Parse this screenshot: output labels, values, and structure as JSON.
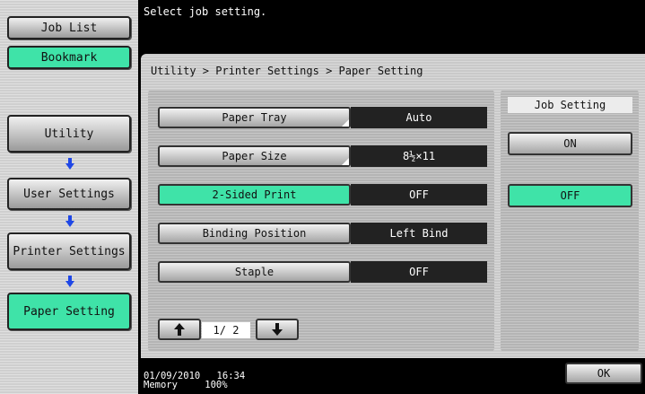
{
  "sidebar": {
    "job_list": "Job List",
    "bookmark": "Bookmark",
    "path": [
      {
        "label": "Utility"
      },
      {
        "label": "User Settings"
      },
      {
        "label": "Printer Settings"
      },
      {
        "label": "Paper Setting"
      }
    ]
  },
  "header": {
    "message": "Select job setting."
  },
  "main": {
    "breadcrumb": "Utility > Printer Settings > Paper Setting",
    "settings": [
      {
        "label": "Paper Tray",
        "value": "Auto"
      },
      {
        "label": "Paper Size",
        "value": "8½×11"
      },
      {
        "label": "2-Sided Print",
        "value": "OFF"
      },
      {
        "label": "Binding Position",
        "value": "Left Bind"
      },
      {
        "label": "Staple",
        "value": "OFF"
      }
    ],
    "page_indicator": "1/ 2"
  },
  "job_setting": {
    "title": "Job Setting",
    "on_label": "ON",
    "off_label": "OFF"
  },
  "footer": {
    "date": "01/09/2010",
    "time": "16:34",
    "memory_label": "Memory",
    "memory_value": "100%",
    "ok_label": "OK"
  },
  "colors": {
    "accent_green": "#3fe3a8",
    "arrow_blue": "#1f47e6"
  }
}
